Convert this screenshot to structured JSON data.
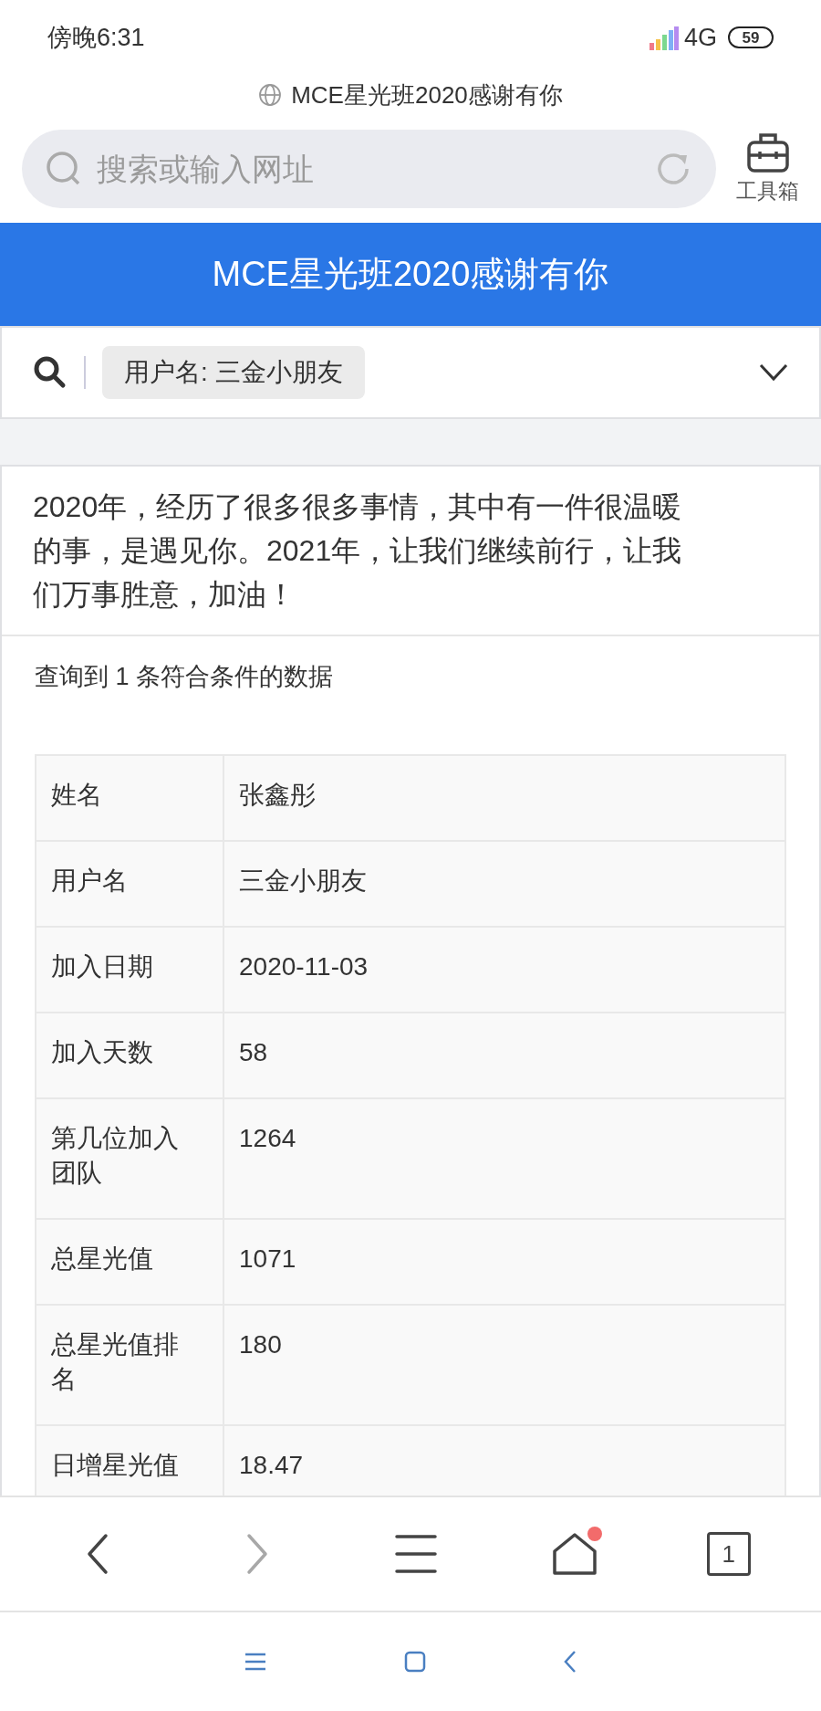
{
  "status_bar": {
    "time": "傍晚6:31",
    "network": "4G",
    "battery": "59"
  },
  "page_title": "MCE星光班2020感谢有你",
  "address_bar": {
    "placeholder": "搜索或输入网址"
  },
  "toolbox": {
    "label": "工具箱"
  },
  "header": {
    "title": "MCE星光班2020感谢有你"
  },
  "filter": {
    "chip": "用户名: 三金小朋友",
    "expanded": false
  },
  "intro": "2020年，经历了很多很多事情，其中有一件很温暖的事，是遇见你。2021年，让我们继续前行，让我们万事胜意，加油！",
  "result_count": "查询到 1 条符合条件的数据",
  "table": {
    "rows": [
      {
        "label": "姓名",
        "value": "张鑫彤"
      },
      {
        "label": "用户名",
        "value": "三金小朋友"
      },
      {
        "label": "加入日期",
        "value": "2020-11-03"
      },
      {
        "label": "加入天数",
        "value": "58"
      },
      {
        "label": "第几位加入团队",
        "value": "1264"
      },
      {
        "label": "总星光值",
        "value": "1071"
      },
      {
        "label": "总星光值排名",
        "value": "180"
      },
      {
        "label": "日增星光值",
        "value": "18.47"
      }
    ]
  },
  "browser_nav": [
    {
      "kind": "back",
      "disabled": false
    },
    {
      "kind": "forward",
      "disabled": true
    },
    {
      "kind": "menu",
      "disabled": false
    },
    {
      "kind": "home",
      "disabled": false,
      "badge": true
    },
    {
      "kind": "tabs",
      "disabled": false,
      "count": "1"
    }
  ]
}
